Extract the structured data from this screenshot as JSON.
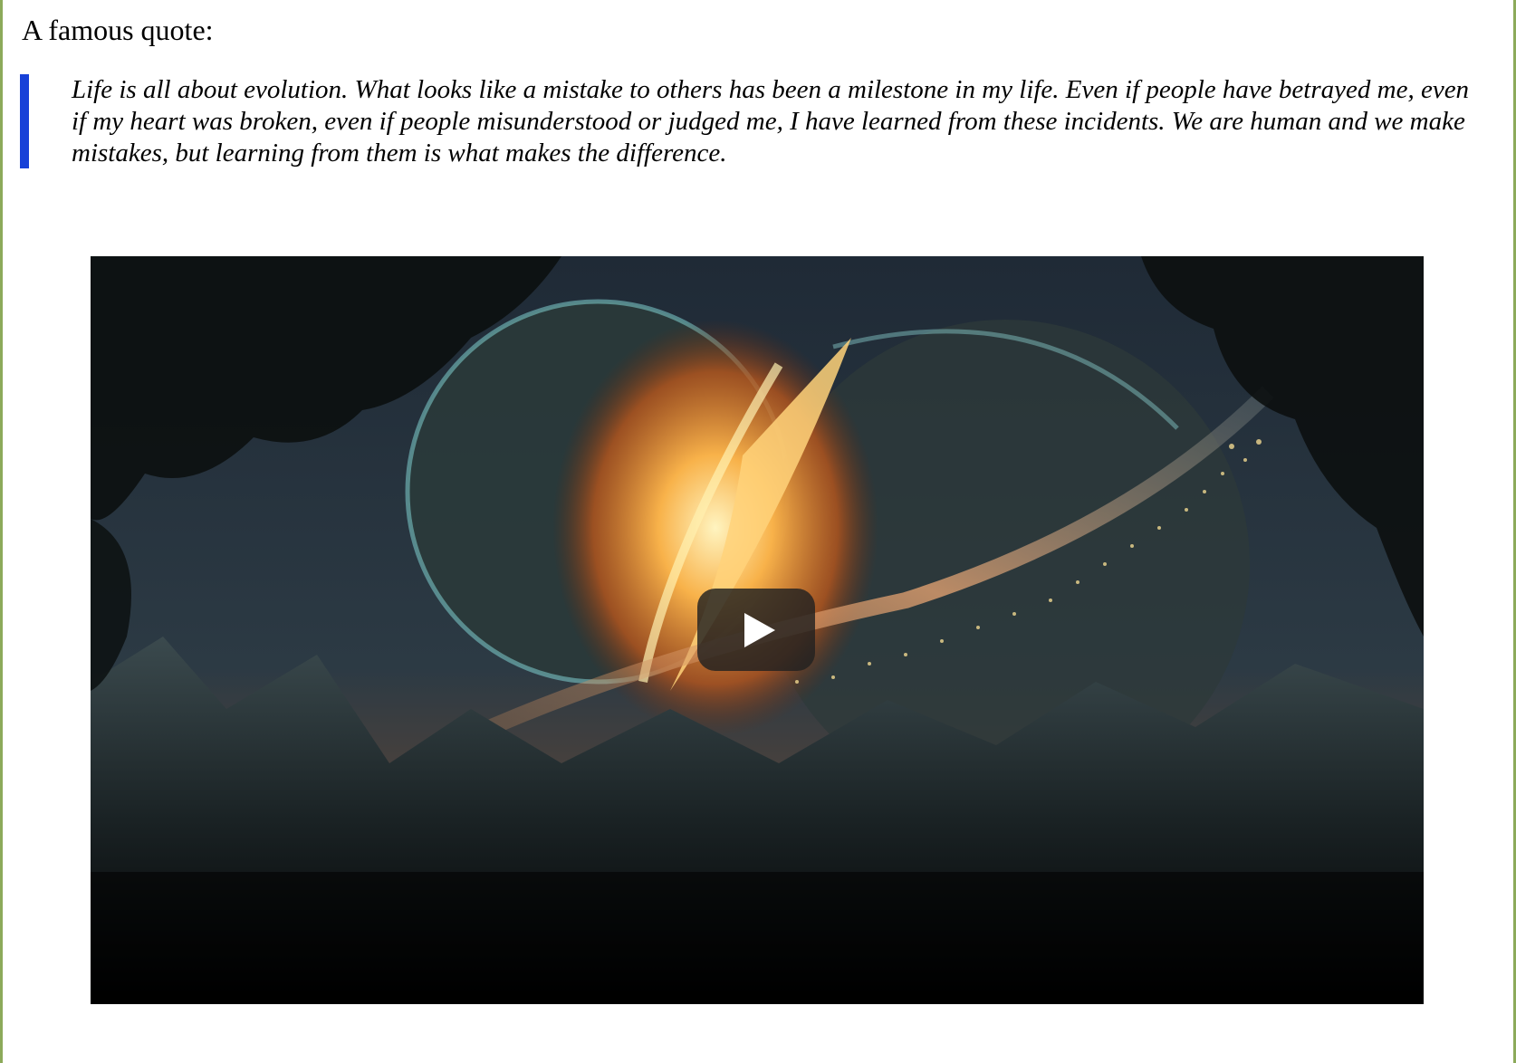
{
  "intro_text": "A famous quote:",
  "quote": {
    "text": "Life is all about evolution. What looks like a mistake to others has been a milestone in my life. Even if people have betrayed me, even if my heart was broken, even if people misunderstood or judged me, I have learned from these incidents. We are human and we make mistakes, but learning from them is what makes the difference.",
    "bar_color": "#1741d8"
  },
  "video": {
    "play_icon": "play-icon"
  },
  "colors": {
    "page_border": "#8caa5a",
    "quote_bar": "#1741d8"
  }
}
